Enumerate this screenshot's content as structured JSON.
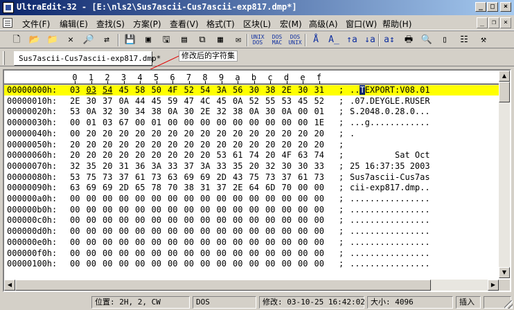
{
  "window": {
    "title": "UltraEdit-32 - [E:\\nls2\\Sus7ascii-Cus7ascii-exp817.dmp*]",
    "min_glyph": "_",
    "max_glyph": "□",
    "close_glyph": "×"
  },
  "menu": {
    "items": [
      "文件(F)",
      "编辑(E)",
      "查找(S)",
      "方案(P)",
      "查看(V)",
      "格式(T)",
      "区块(L)",
      "宏(M)",
      "高级(A)",
      "窗口(W)",
      "帮助(H)"
    ],
    "doc_min": "_",
    "doc_restore": "❐",
    "doc_close": "×"
  },
  "toolbar": {
    "buttons": [
      {
        "icon": "new-file-icon",
        "glyph": "🗋"
      },
      {
        "icon": "open-folder-icon",
        "glyph": "📂"
      },
      {
        "icon": "open-recent-icon",
        "glyph": "📁"
      },
      {
        "icon": "close-file-icon",
        "glyph": "✕"
      },
      {
        "icon": "find-in-files-icon",
        "glyph": "🔎"
      },
      {
        "icon": "replace-in-files-icon",
        "glyph": "⇄"
      },
      {
        "icon": "save-icon",
        "glyph": "💾"
      },
      {
        "icon": "save-all-icon",
        "glyph": "▣"
      },
      {
        "icon": "save-as-icon",
        "glyph": "🖫"
      },
      {
        "icon": "print-preview-icon",
        "glyph": "▤"
      },
      {
        "icon": "copy-file-icon",
        "glyph": "⧉"
      },
      {
        "icon": "toggle-icon",
        "glyph": "▦"
      },
      {
        "icon": "email-icon",
        "glyph": "✉"
      },
      {
        "icon": "unix-to-dos-icon",
        "glyph": "UNIX\nDOS"
      },
      {
        "icon": "dos-to-mac-icon",
        "glyph": "DOS\nMAC"
      },
      {
        "icon": "dos-to-unix-icon",
        "glyph": "DOS\nUNIX"
      },
      {
        "icon": "ascii-to-unicode-icon",
        "glyph": "Å"
      },
      {
        "icon": "unicode-to-ascii-icon",
        "glyph": "A̲"
      },
      {
        "icon": "sort-az-icon",
        "glyph": "↑a"
      },
      {
        "icon": "sort-za-icon",
        "glyph": "↓a"
      },
      {
        "icon": "sort-az2-icon",
        "glyph": "a↕"
      },
      {
        "icon": "print-icon",
        "glyph": "🖶"
      },
      {
        "icon": "find-icon",
        "glyph": "🔍"
      },
      {
        "icon": "document-icon",
        "glyph": "▯"
      },
      {
        "icon": "options-icon",
        "glyph": "☷"
      },
      {
        "icon": "tools-icon",
        "glyph": "⚒"
      }
    ]
  },
  "tab": {
    "label": "Sus7ascii-Cus7ascii-exp817.dmp*"
  },
  "annotation": {
    "label": "修改后的字符集"
  },
  "hex": {
    "ruler": [
      "0",
      "1",
      "2",
      "3",
      "4",
      "5",
      "6",
      "7",
      "8",
      "9",
      "a",
      "b",
      "c",
      "d",
      "e",
      "f"
    ],
    "rows": [
      {
        "addr": "00000000h:",
        "bytes": [
          "03",
          "03",
          "54",
          "45",
          "58",
          "50",
          "4F",
          "52",
          "54",
          "3A",
          "56",
          "30",
          "38",
          "2E",
          "30",
          "31"
        ],
        "sep": ";",
        "ascii_pre": "..",
        "ascii_cursor": "T",
        "ascii_post": "EXPORT:V08.01",
        "highlight": true
      },
      {
        "addr": "00000010h:",
        "bytes": [
          "2E",
          "30",
          "37",
          "0A",
          "44",
          "45",
          "59",
          "47",
          "4C",
          "45",
          "0A",
          "52",
          "55",
          "53",
          "45",
          "52"
        ],
        "sep": ";",
        "ascii": ".07.DEYGLE.RUSER"
      },
      {
        "addr": "00000020h:",
        "bytes": [
          "53",
          "0A",
          "32",
          "30",
          "34",
          "38",
          "0A",
          "30",
          "2E",
          "32",
          "38",
          "0A",
          "30",
          "0A",
          "00",
          "01"
        ],
        "sep": ";",
        "ascii": "S.2048.0.28.0..."
      },
      {
        "addr": "00000030h:",
        "bytes": [
          "00",
          "01",
          "03",
          "67",
          "00",
          "01",
          "00",
          "00",
          "00",
          "00",
          "00",
          "00",
          "00",
          "00",
          "00",
          "1E"
        ],
        "sep": ";",
        "ascii": "...g............"
      },
      {
        "addr": "00000040h:",
        "bytes": [
          "00",
          "20",
          "20",
          "20",
          "20",
          "20",
          "20",
          "20",
          "20",
          "20",
          "20",
          "20",
          "20",
          "20",
          "20",
          "20"
        ],
        "sep": ";",
        "ascii": "."
      },
      {
        "addr": "00000050h:",
        "bytes": [
          "20",
          "20",
          "20",
          "20",
          "20",
          "20",
          "20",
          "20",
          "20",
          "20",
          "20",
          "20",
          "20",
          "20",
          "20",
          "20"
        ],
        "sep": ";",
        "ascii": ""
      },
      {
        "addr": "00000060h:",
        "bytes": [
          "20",
          "20",
          "20",
          "20",
          "20",
          "20",
          "20",
          "20",
          "20",
          "53",
          "61",
          "74",
          "20",
          "4F",
          "63",
          "74"
        ],
        "sep": ";",
        "ascii": "         Sat Oct"
      },
      {
        "addr": "00000070h:",
        "bytes": [
          "32",
          "35",
          "20",
          "31",
          "36",
          "3A",
          "33",
          "37",
          "3A",
          "33",
          "35",
          "20",
          "32",
          "30",
          "30",
          "33"
        ],
        "sep": ";",
        "ascii": "25 16:37:35 2003"
      },
      {
        "addr": "00000080h:",
        "bytes": [
          "53",
          "75",
          "73",
          "37",
          "61",
          "73",
          "63",
          "69",
          "69",
          "2D",
          "43",
          "75",
          "73",
          "37",
          "61",
          "73"
        ],
        "sep": ";",
        "ascii": "Sus7ascii-Cus7as"
      },
      {
        "addr": "00000090h:",
        "bytes": [
          "63",
          "69",
          "69",
          "2D",
          "65",
          "78",
          "70",
          "38",
          "31",
          "37",
          "2E",
          "64",
          "6D",
          "70",
          "00",
          "00"
        ],
        "sep": ";",
        "ascii": "cii-exp817.dmp.."
      },
      {
        "addr": "000000a0h:",
        "bytes": [
          "00",
          "00",
          "00",
          "00",
          "00",
          "00",
          "00",
          "00",
          "00",
          "00",
          "00",
          "00",
          "00",
          "00",
          "00",
          "00"
        ],
        "sep": ";",
        "ascii": "................"
      },
      {
        "addr": "000000b0h:",
        "bytes": [
          "00",
          "00",
          "00",
          "00",
          "00",
          "00",
          "00",
          "00",
          "00",
          "00",
          "00",
          "00",
          "00",
          "00",
          "00",
          "00"
        ],
        "sep": ";",
        "ascii": "................"
      },
      {
        "addr": "000000c0h:",
        "bytes": [
          "00",
          "00",
          "00",
          "00",
          "00",
          "00",
          "00",
          "00",
          "00",
          "00",
          "00",
          "00",
          "00",
          "00",
          "00",
          "00"
        ],
        "sep": ";",
        "ascii": "................"
      },
      {
        "addr": "000000d0h:",
        "bytes": [
          "00",
          "00",
          "00",
          "00",
          "00",
          "00",
          "00",
          "00",
          "00",
          "00",
          "00",
          "00",
          "00",
          "00",
          "00",
          "00"
        ],
        "sep": ";",
        "ascii": "................"
      },
      {
        "addr": "000000e0h:",
        "bytes": [
          "00",
          "00",
          "00",
          "00",
          "00",
          "00",
          "00",
          "00",
          "00",
          "00",
          "00",
          "00",
          "00",
          "00",
          "00",
          "00"
        ],
        "sep": ";",
        "ascii": "................"
      },
      {
        "addr": "000000f0h:",
        "bytes": [
          "00",
          "00",
          "00",
          "00",
          "00",
          "00",
          "00",
          "00",
          "00",
          "00",
          "00",
          "00",
          "00",
          "00",
          "00",
          "00"
        ],
        "sep": ";",
        "ascii": "................"
      },
      {
        "addr": "00000100h:",
        "bytes": [
          "00",
          "00",
          "00",
          "00",
          "00",
          "00",
          "00",
          "00",
          "00",
          "00",
          "00",
          "00",
          "00",
          "00",
          "00",
          "00"
        ],
        "sep": ";",
        "ascii": "................"
      }
    ]
  },
  "scroll": {
    "up": "▲",
    "down": "▼",
    "left": "◀",
    "right": "▶"
  },
  "status": {
    "position": "位置: 2H, 2, CW",
    "format": "DOS",
    "modified": "修改: 03-10-25 16:42:02",
    "size": "大小: 4096",
    "mode": "插入"
  }
}
